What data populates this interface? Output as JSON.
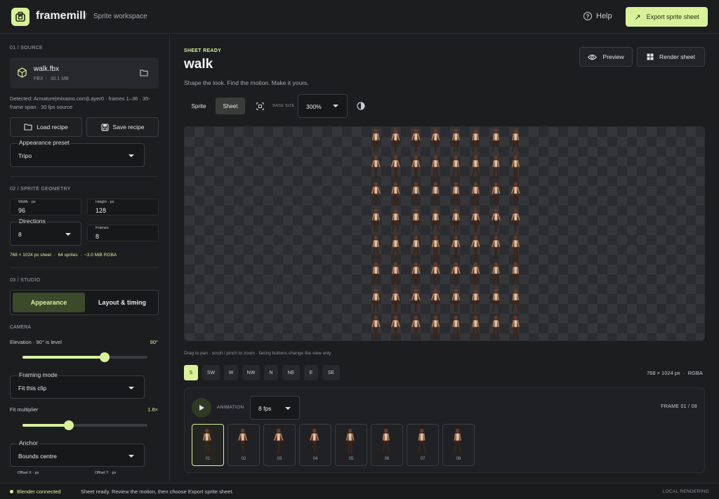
{
  "header": {
    "brand": "framemill",
    "breadcrumb": "Sprite workspace",
    "help_label": "Help",
    "export_label": "Export sprite sheet"
  },
  "sidebar": {
    "source": {
      "section_title": "01 / SOURCE",
      "file_name": "walk.fbx",
      "file_type": "FBX",
      "file_size": "30.1 MB",
      "detected": "Detected: Armature|mixamo.com|Layer0 · frames 1–36 · 35-frame span · 30 fps source",
      "load_recipe": "Load recipe",
      "save_recipe": "Save recipe",
      "appearance_preset_label": "Appearance preset",
      "appearance_preset_value": "Tripo"
    },
    "geometry": {
      "section_title": "02 / SPRITE GEOMETRY",
      "width_label": "Width · px",
      "width_value": "96",
      "height_label": "Height · px",
      "height_value": "128",
      "directions_label": "Directions",
      "directions_value": "8",
      "frames_label": "Frames",
      "frames_value": "8",
      "summary_sheet": "768 × 1024 px sheet",
      "summary_sprites": "64 sprites",
      "summary_mem": "~3.0 MiB RGBA"
    },
    "studio": {
      "section_title": "03 / STUDIO",
      "tab_appearance": "Appearance",
      "tab_layout": "Layout & timing",
      "camera_label": "CAMERA",
      "elevation_label": "Elevation · 90° is level",
      "elevation_value": "90°",
      "elevation_fraction": 0.66,
      "framing_label": "Framing mode",
      "framing_value": "Fit this clip",
      "fit_label": "Fit multiplier",
      "fit_value": "1.8×",
      "fit_fraction": 0.37,
      "anchor_label": "Anchor",
      "anchor_value": "Bounds centre",
      "offset_x_label": "Offset X · px",
      "offset_y_label": "Offset Y · px"
    }
  },
  "main": {
    "eyebrow": "SHEET READY",
    "title": "walk",
    "subtitle": "Shape the look. Find the motion. Make it yours.",
    "preview_label": "Preview",
    "render_label": "Render sheet",
    "toolbar": {
      "sprite_tab": "Sprite",
      "sheet_tab": "Sheet",
      "base_size_label": "BASE SIZE",
      "base_size_value": "300%"
    },
    "hint": "Drag to pan · scroll / pinch to zoom · facing buttons change the view only",
    "directions": [
      "S",
      "SW",
      "W",
      "NW",
      "N",
      "NE",
      "E",
      "SE"
    ],
    "active_direction": "S",
    "dims": "768 × 1024 px",
    "format": "RGBA",
    "animation": {
      "label": "ANIMATION",
      "fps": "8 fps",
      "frame_label": "FRAME  01 / 08",
      "frames": [
        "01",
        "02",
        "03",
        "04",
        "05",
        "06",
        "07",
        "08"
      ]
    }
  },
  "status": {
    "connected": "Blender connected",
    "message": "Sheet ready. Review the motion, then choose Export sprite sheet.",
    "right": "LOCAL RENDERING"
  },
  "colors": {
    "accent": "#d9f29a",
    "background": "#1c1d1f",
    "panel": "#26282b"
  }
}
